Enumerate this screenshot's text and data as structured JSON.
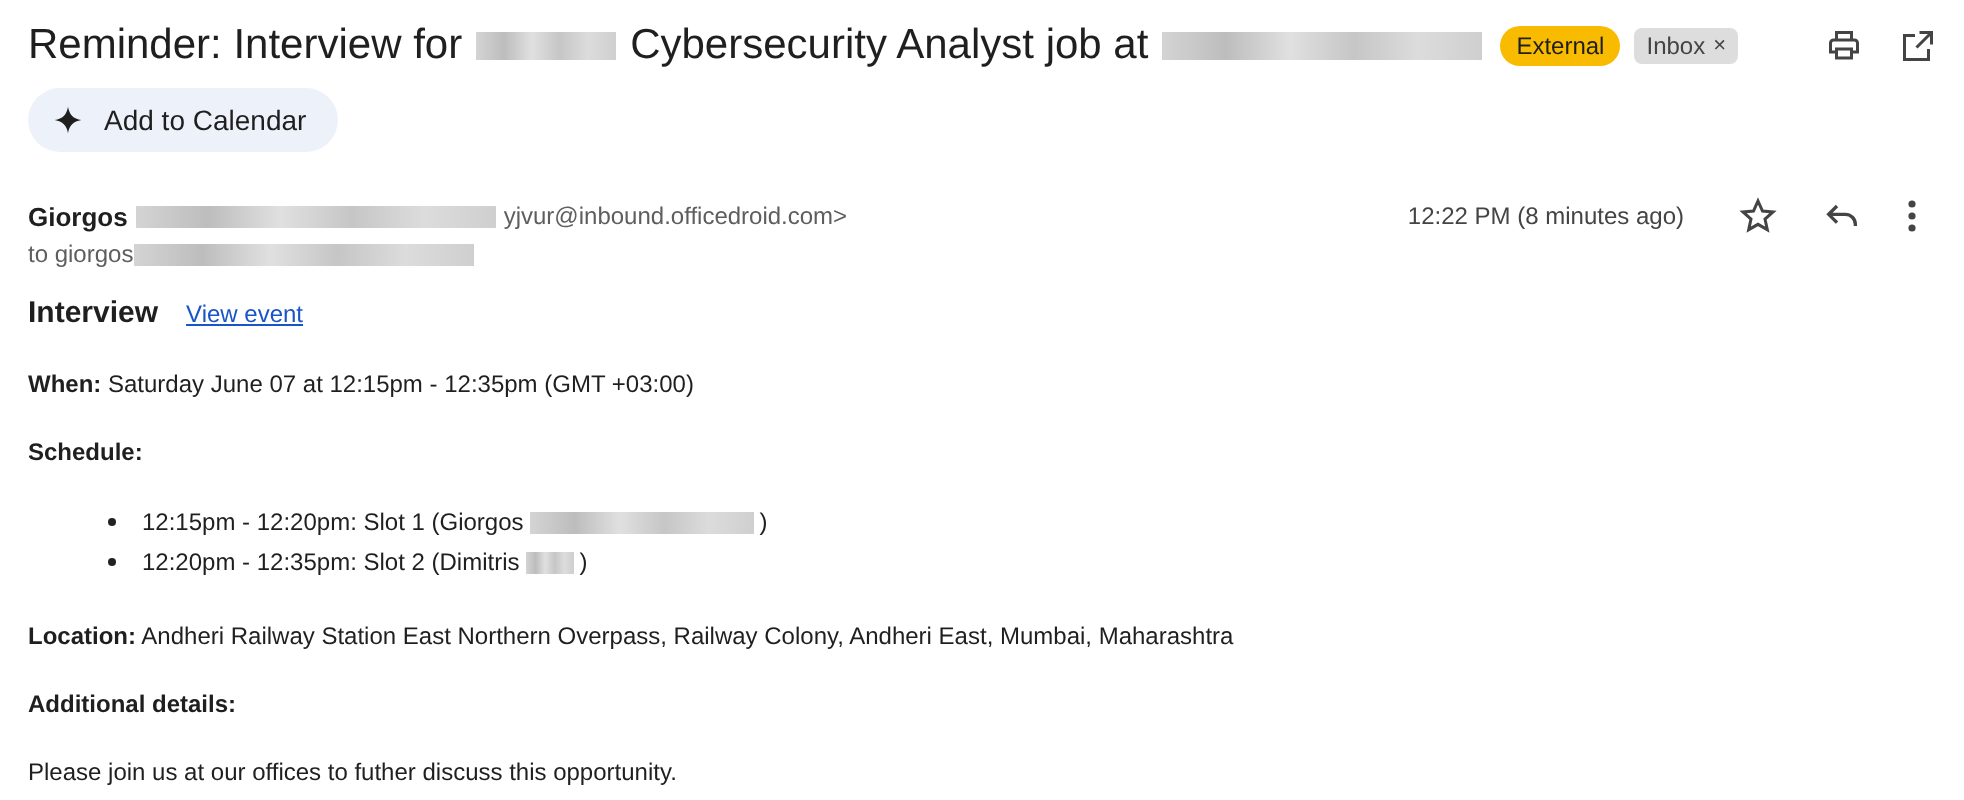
{
  "subject": {
    "before": "Reminder: Interview for",
    "middle": "Cybersecurity Analyst job at"
  },
  "labels": [
    {
      "text": "External",
      "kind": "external"
    },
    {
      "text": "Inbox",
      "kind": "inbox",
      "close": "×"
    }
  ],
  "add_to_calendar": "Add to Calendar",
  "sender": {
    "name": "Giorgos",
    "address_tail": "yjvur@inbound.officedroid.com>"
  },
  "recipient": "to giorgos",
  "time": "12:22 PM (8 minutes ago)",
  "starred": false,
  "event": {
    "title": "Interview",
    "link": "View event"
  },
  "when": "**When:** Saturday June 07 at 12:15pm - 12:35pm (GMT +03:00)",
  "schedule_label": "Schedule:",
  "slots": [
    {
      "text": "12:15pm - 12:20pm: Slot 1 (Giorgos",
      "close": ")"
    },
    {
      "text": "12:20pm - 12:35pm: Slot 2 (Dimitris",
      "close": ")"
    }
  ],
  "location": "**Location:** Andheri Railway Station East Northern Overpass, Railway Colony, Andheri East, Mumbai, Maharashtra",
  "details_label": "Additional details:",
  "details": "Please join us at our offices to futher discuss this opportunity."
}
